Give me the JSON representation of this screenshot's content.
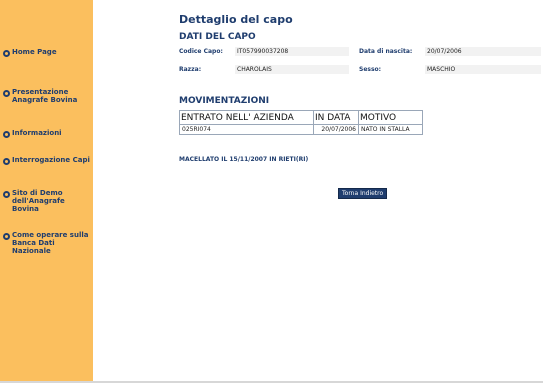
{
  "sidebar": {
    "items": [
      {
        "label": "Home Page"
      },
      {
        "label": "Presentazione Anagrafe Bovina"
      },
      {
        "label": "Informazioni"
      },
      {
        "label": "Interrogazione Capi"
      },
      {
        "label": "Sito di Demo dell'Anagrafe Bovina"
      },
      {
        "label": "Come operare sulla Banca Dati Nazionale"
      }
    ]
  },
  "main": {
    "title": "Dettaglio del capo",
    "dati_title": "DATI DEL CAPO",
    "fields": {
      "codice_label": "Codice Capo:",
      "codice_value": "IT057990037208",
      "nascita_label": "Data di nascita:",
      "nascita_value": "20/07/2006",
      "razza_label": "Razza:",
      "razza_value": "CHAROLAIS",
      "sesso_label": "Sesso:",
      "sesso_value": "MASCHIO"
    },
    "movimentazioni_title": "MOVIMENTAZIONI",
    "table": {
      "headers": [
        "ENTRATO NELL' AZIENDA",
        "IN DATA",
        "MOTIVO"
      ],
      "rows": [
        [
          "025RI074",
          "20/07/2006",
          "NATO IN STALLA"
        ]
      ]
    },
    "slaughter_note": "MACELLATO IL 15/11/2007 IN RIETI(RI)",
    "back_button": "Torna Indietro"
  },
  "colors": {
    "sidebar_bg": "#fbbf5e",
    "accent_navy": "#1f3d6e"
  }
}
